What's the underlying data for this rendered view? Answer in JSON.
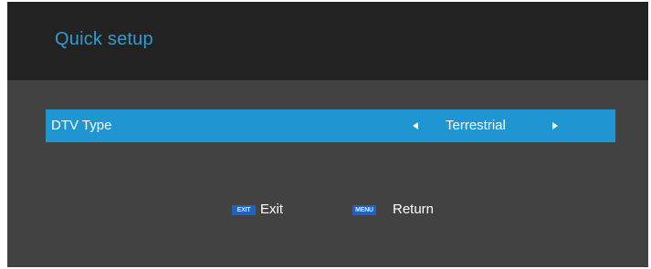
{
  "header": {
    "title": "Quick setup"
  },
  "settings": {
    "dtv_type": {
      "label": "DTV Type",
      "value": "Terrestrial"
    }
  },
  "footer": {
    "exit": {
      "key": "EXIT",
      "label": "Exit"
    },
    "return": {
      "key": "MENU",
      "label": "Return"
    }
  },
  "colors": {
    "header_bg": "#222222",
    "body_bg": "#424242",
    "accent_title": "#2f9bd6",
    "selected_row": "#1f96d2",
    "key_badge": "#1b63c4"
  }
}
